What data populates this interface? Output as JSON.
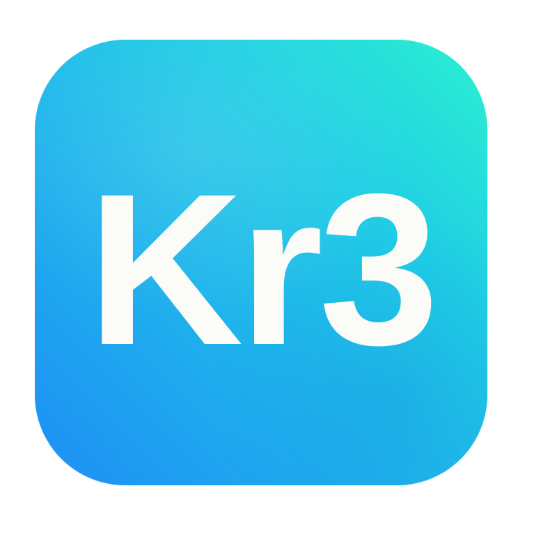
{
  "icon": {
    "label": "Kr3",
    "gradient_colors": [
      "#2cf0d0",
      "#20cfe4",
      "#1fb4ec",
      "#1e8ef5"
    ],
    "text_color": "#fbfbf8"
  },
  "background": "#ffffff"
}
